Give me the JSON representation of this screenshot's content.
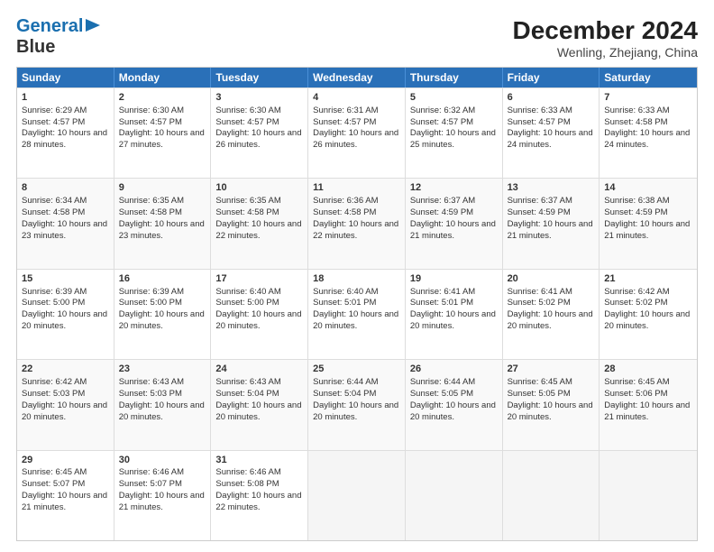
{
  "logo": {
    "line1": "General",
    "line2": "Blue"
  },
  "title": "December 2024",
  "subtitle": "Wenling, Zhejiang, China",
  "days_of_week": [
    "Sunday",
    "Monday",
    "Tuesday",
    "Wednesday",
    "Thursday",
    "Friday",
    "Saturday"
  ],
  "weeks": [
    [
      {
        "day": 1,
        "sunrise": "6:29 AM",
        "sunset": "4:57 PM",
        "daylight": "10 hours and 28 minutes."
      },
      {
        "day": 2,
        "sunrise": "6:30 AM",
        "sunset": "4:57 PM",
        "daylight": "10 hours and 27 minutes."
      },
      {
        "day": 3,
        "sunrise": "6:30 AM",
        "sunset": "4:57 PM",
        "daylight": "10 hours and 26 minutes."
      },
      {
        "day": 4,
        "sunrise": "6:31 AM",
        "sunset": "4:57 PM",
        "daylight": "10 hours and 26 minutes."
      },
      {
        "day": 5,
        "sunrise": "6:32 AM",
        "sunset": "4:57 PM",
        "daylight": "10 hours and 25 minutes."
      },
      {
        "day": 6,
        "sunrise": "6:33 AM",
        "sunset": "4:57 PM",
        "daylight": "10 hours and 24 minutes."
      },
      {
        "day": 7,
        "sunrise": "6:33 AM",
        "sunset": "4:58 PM",
        "daylight": "10 hours and 24 minutes."
      }
    ],
    [
      {
        "day": 8,
        "sunrise": "6:34 AM",
        "sunset": "4:58 PM",
        "daylight": "10 hours and 23 minutes."
      },
      {
        "day": 9,
        "sunrise": "6:35 AM",
        "sunset": "4:58 PM",
        "daylight": "10 hours and 23 minutes."
      },
      {
        "day": 10,
        "sunrise": "6:35 AM",
        "sunset": "4:58 PM",
        "daylight": "10 hours and 22 minutes."
      },
      {
        "day": 11,
        "sunrise": "6:36 AM",
        "sunset": "4:58 PM",
        "daylight": "10 hours and 22 minutes."
      },
      {
        "day": 12,
        "sunrise": "6:37 AM",
        "sunset": "4:59 PM",
        "daylight": "10 hours and 21 minutes."
      },
      {
        "day": 13,
        "sunrise": "6:37 AM",
        "sunset": "4:59 PM",
        "daylight": "10 hours and 21 minutes."
      },
      {
        "day": 14,
        "sunrise": "6:38 AM",
        "sunset": "4:59 PM",
        "daylight": "10 hours and 21 minutes."
      }
    ],
    [
      {
        "day": 15,
        "sunrise": "6:39 AM",
        "sunset": "5:00 PM",
        "daylight": "10 hours and 20 minutes."
      },
      {
        "day": 16,
        "sunrise": "6:39 AM",
        "sunset": "5:00 PM",
        "daylight": "10 hours and 20 minutes."
      },
      {
        "day": 17,
        "sunrise": "6:40 AM",
        "sunset": "5:00 PM",
        "daylight": "10 hours and 20 minutes."
      },
      {
        "day": 18,
        "sunrise": "6:40 AM",
        "sunset": "5:01 PM",
        "daylight": "10 hours and 20 minutes."
      },
      {
        "day": 19,
        "sunrise": "6:41 AM",
        "sunset": "5:01 PM",
        "daylight": "10 hours and 20 minutes."
      },
      {
        "day": 20,
        "sunrise": "6:41 AM",
        "sunset": "5:02 PM",
        "daylight": "10 hours and 20 minutes."
      },
      {
        "day": 21,
        "sunrise": "6:42 AM",
        "sunset": "5:02 PM",
        "daylight": "10 hours and 20 minutes."
      }
    ],
    [
      {
        "day": 22,
        "sunrise": "6:42 AM",
        "sunset": "5:03 PM",
        "daylight": "10 hours and 20 minutes."
      },
      {
        "day": 23,
        "sunrise": "6:43 AM",
        "sunset": "5:03 PM",
        "daylight": "10 hours and 20 minutes."
      },
      {
        "day": 24,
        "sunrise": "6:43 AM",
        "sunset": "5:04 PM",
        "daylight": "10 hours and 20 minutes."
      },
      {
        "day": 25,
        "sunrise": "6:44 AM",
        "sunset": "5:04 PM",
        "daylight": "10 hours and 20 minutes."
      },
      {
        "day": 26,
        "sunrise": "6:44 AM",
        "sunset": "5:05 PM",
        "daylight": "10 hours and 20 minutes."
      },
      {
        "day": 27,
        "sunrise": "6:45 AM",
        "sunset": "5:05 PM",
        "daylight": "10 hours and 20 minutes."
      },
      {
        "day": 28,
        "sunrise": "6:45 AM",
        "sunset": "5:06 PM",
        "daylight": "10 hours and 21 minutes."
      }
    ],
    [
      {
        "day": 29,
        "sunrise": "6:45 AM",
        "sunset": "5:07 PM",
        "daylight": "10 hours and 21 minutes."
      },
      {
        "day": 30,
        "sunrise": "6:46 AM",
        "sunset": "5:07 PM",
        "daylight": "10 hours and 21 minutes."
      },
      {
        "day": 31,
        "sunrise": "6:46 AM",
        "sunset": "5:08 PM",
        "daylight": "10 hours and 22 minutes."
      },
      null,
      null,
      null,
      null
    ]
  ]
}
